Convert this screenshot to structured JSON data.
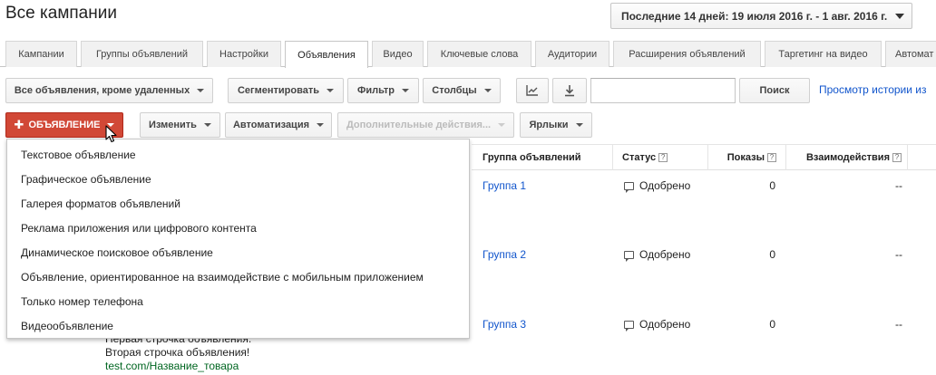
{
  "page_title": "Все кампании",
  "date_range": "Последние 14 дней: 19 июля 2016 г. - 1 авг. 2016 г.",
  "tabs": [
    {
      "label": "Кампании"
    },
    {
      "label": "Группы объявлений"
    },
    {
      "label": "Настройки"
    },
    {
      "label": "Объявления",
      "active": true
    },
    {
      "label": "Видео"
    },
    {
      "label": "Ключевые слова"
    },
    {
      "label": "Аудитории"
    },
    {
      "label": "Расширения объявлений"
    },
    {
      "label": "Таргетинг на видео"
    },
    {
      "label": "Автомат"
    }
  ],
  "toolbar1": {
    "filter_all": "Все объявления, кроме удаленных",
    "segment": "Сегментировать",
    "filter": "Фильтр",
    "columns": "Столбцы",
    "search_button": "Поиск",
    "history_link": "Просмотр истории из"
  },
  "toolbar2": {
    "new_ad": "ОБЪЯВЛЕНИЕ",
    "edit": "Изменить",
    "automation": "Автоматизация",
    "more_actions": "Дополнительные действия...",
    "labels": "Ярлыки"
  },
  "menu_items": [
    "Текстовое объявление",
    "Графическое объявление",
    "Галерея форматов объявлений",
    "Реклама приложения или цифрового контента",
    "Динамическое поисковое объявление",
    "Объявление, ориентированное на взаимодействие с мобильным приложением",
    "Только номер телефона",
    "Видеообъявление"
  ],
  "table": {
    "headers": {
      "ad_group": "Группа объявлений",
      "status": "Статус",
      "impressions": "Показы",
      "interactions": "Взаимодействия",
      "help": "?"
    },
    "rows": [
      {
        "group": "Группа 1",
        "status": "Одобрено",
        "impressions": "0",
        "interactions": "--"
      },
      {
        "group": "Группа 2",
        "status": "Одобрено",
        "impressions": "0",
        "interactions": "--"
      },
      {
        "group": "Группа 3",
        "status": "Одобрено",
        "impressions": "0",
        "interactions": "--"
      }
    ]
  },
  "ad_preview": {
    "line1": "Первая строчка объявления.",
    "line2": "Вторая строчка объявления!",
    "url": "test.com/Название_товара"
  },
  "colors": {
    "accent_red": "#d14836",
    "link_blue": "#1155cc",
    "url_green": "#006621"
  },
  "icons": {
    "chart": "line-chart-icon",
    "download": "download-icon",
    "status": "speech-bubble-icon",
    "cursor": "mouse-pointer-icon"
  }
}
